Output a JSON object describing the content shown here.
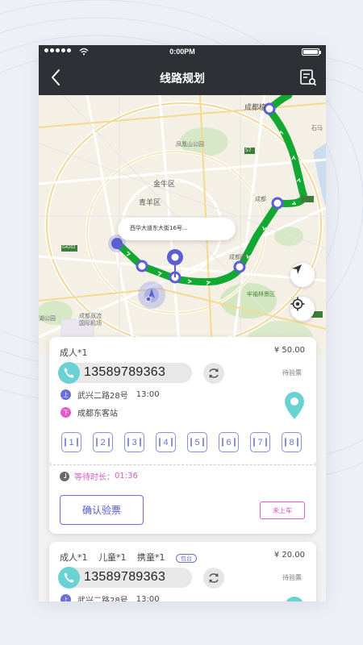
{
  "status_bar": {
    "time": "0:00PM"
  },
  "nav": {
    "title": "线路规划"
  },
  "map": {
    "labels": {
      "chengdu_top": "成都植",
      "right_edge": "石马",
      "fenghuang": "凤凰山公园",
      "jinniu": "金牛区",
      "qingyang": "青羊区",
      "chengdu_dong": "成都",
      "chenghua": "成都图",
      "hongpai": "牢袖林景区",
      "airport": "成都双流\n国际机场",
      "lake": "湖公园",
      "g4202": "G4202",
      "s7": "S7"
    },
    "address_bubble": "西华大道东大街16号..."
  },
  "orders": [
    {
      "passengers": [
        "成人*1"
      ],
      "badge": "",
      "price": "¥ 50.00",
      "phone": "13589789363",
      "status": "待验票",
      "pickup_tag": "上",
      "pickup": "武兴二路28号",
      "pickup_time": "13:00",
      "dropoff_tag": "下",
      "dropoff": "成都东客站",
      "seats": [
        "1",
        "2",
        "3",
        "4",
        "5",
        "6",
        "7",
        "8"
      ],
      "wait_label": "等待时长：",
      "wait_time": "01:36",
      "confirm_label": "确认验票",
      "not_boarded_label": "未上车"
    },
    {
      "passengers": [
        "成人*1",
        "儿童*1",
        "携童*1"
      ],
      "badge": "包台",
      "price": "¥ 20.00",
      "phone": "13589789363",
      "status": "待验票",
      "pickup_tag": "上",
      "pickup": "武兴二路28号",
      "pickup_time": "13:00"
    }
  ],
  "colors": {
    "route": "#12a832",
    "accent": "#6a6fd8",
    "pink": "#e15bc4",
    "teal": "#6ad2d2",
    "navbar": "#2e3035"
  }
}
